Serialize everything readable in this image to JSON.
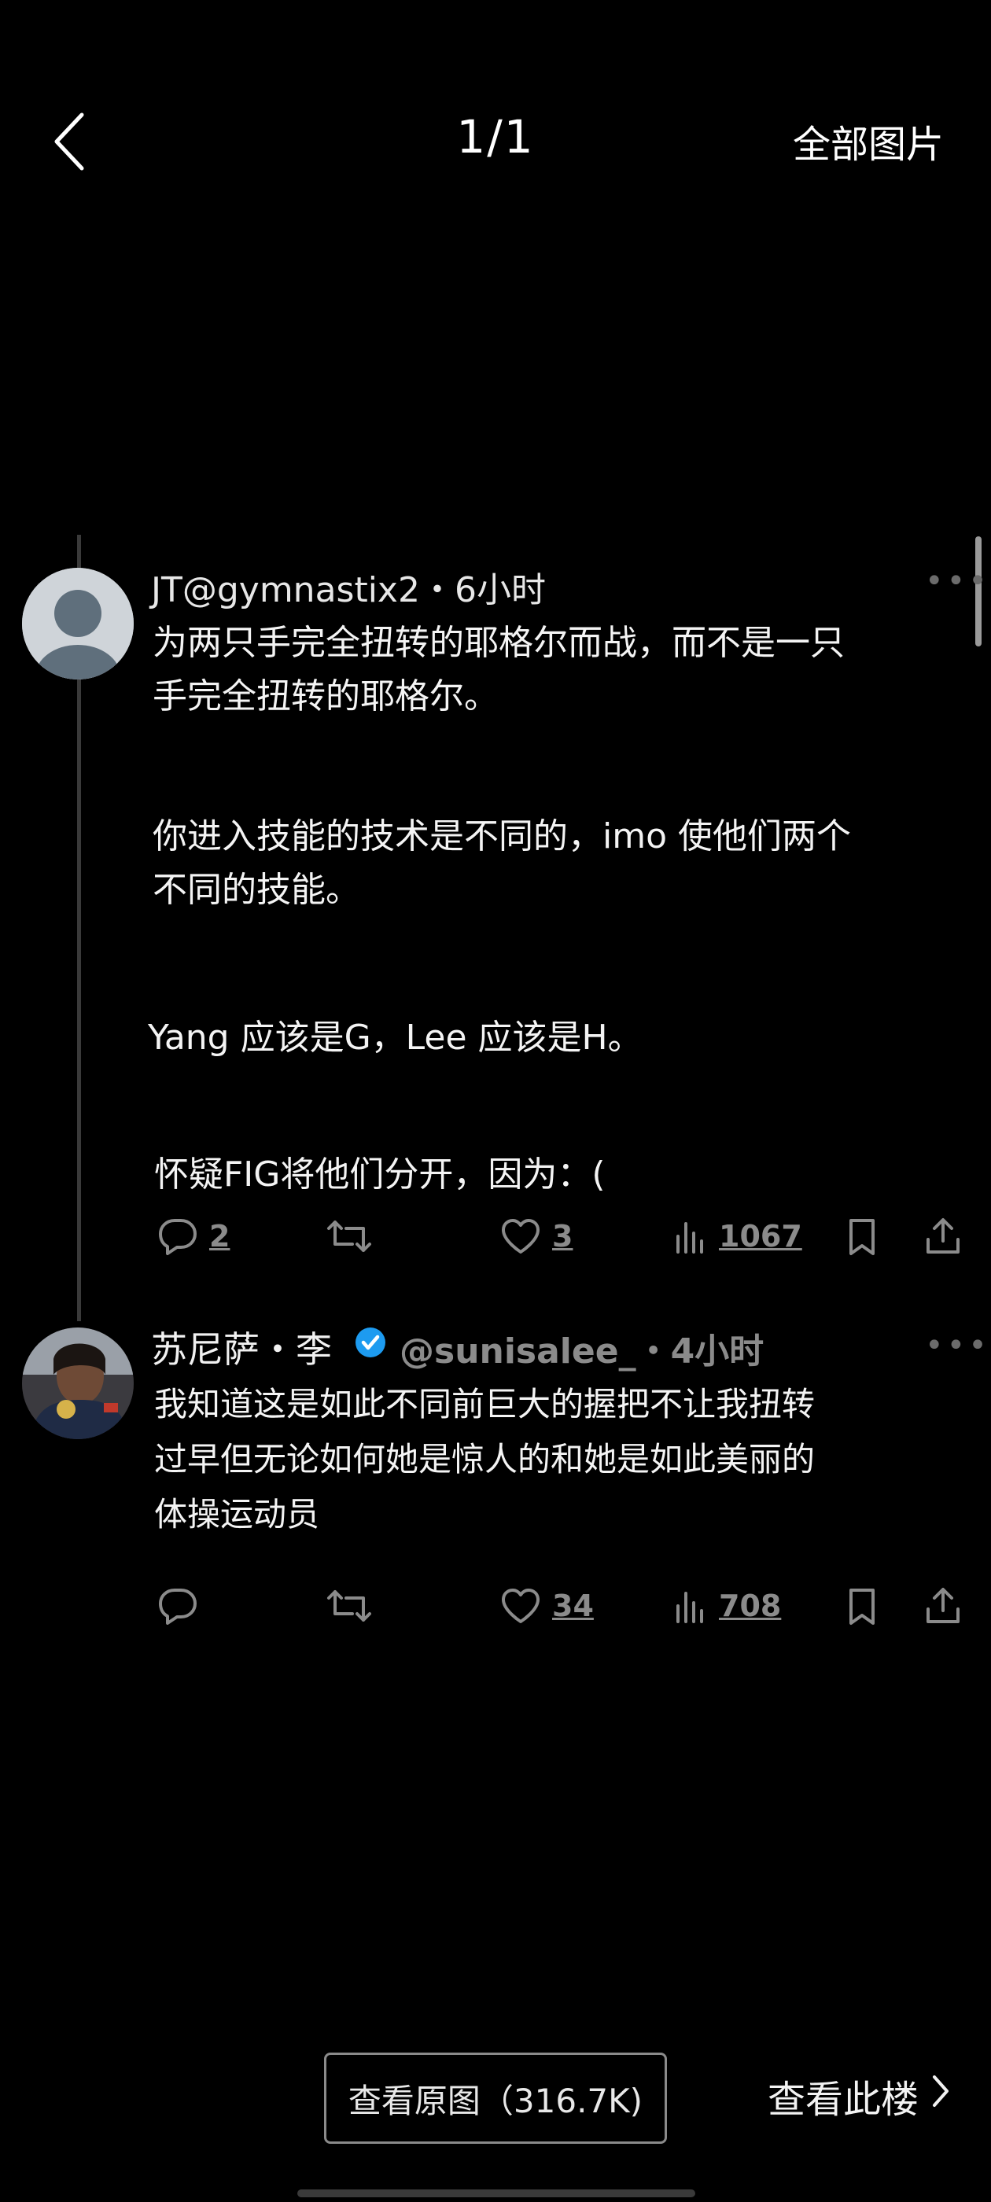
{
  "header": {
    "counter": "1/1",
    "all_images": "全部图片"
  },
  "post1": {
    "handle": "JT@gymnastix2・6小时",
    "para1_line1": "为两只手完全扭转的耶格尔而战，而不是一只",
    "para1_line2": "手完全扭转的耶格尔。",
    "para2_line1": "你进入技能的技术是不同的，imo 使他们两个",
    "para2_line2": "不同的技能。",
    "para3": "Yang 应该是G，Lee 应该是H。",
    "para4": "怀疑FIG将他们分开，因为：(",
    "reply_count": "2",
    "like_count": "3",
    "view_count": "1067"
  },
  "post2": {
    "name": "苏尼萨・李",
    "handle": "@sunisalee_・4小时",
    "line1": "我知道这是如此不同前巨大的握把不让我扭转",
    "line2": "过早但无论如何她是惊人的和她是如此美丽的",
    "line3": "体操运动员",
    "like_count": "34",
    "view_count": "708"
  },
  "footer": {
    "view_original": "查看原图（316.7K)",
    "view_floor": "查看此楼"
  },
  "colors": {
    "background": "#000000",
    "verified": "#1d9bf0",
    "muted": "#8b8b8b"
  },
  "icons": [
    "back-arrow-icon",
    "more-icon",
    "reply-icon",
    "retweet-icon",
    "like-icon",
    "views-icon",
    "bookmark-icon",
    "share-icon",
    "verified-icon",
    "chevron-right-icon"
  ]
}
